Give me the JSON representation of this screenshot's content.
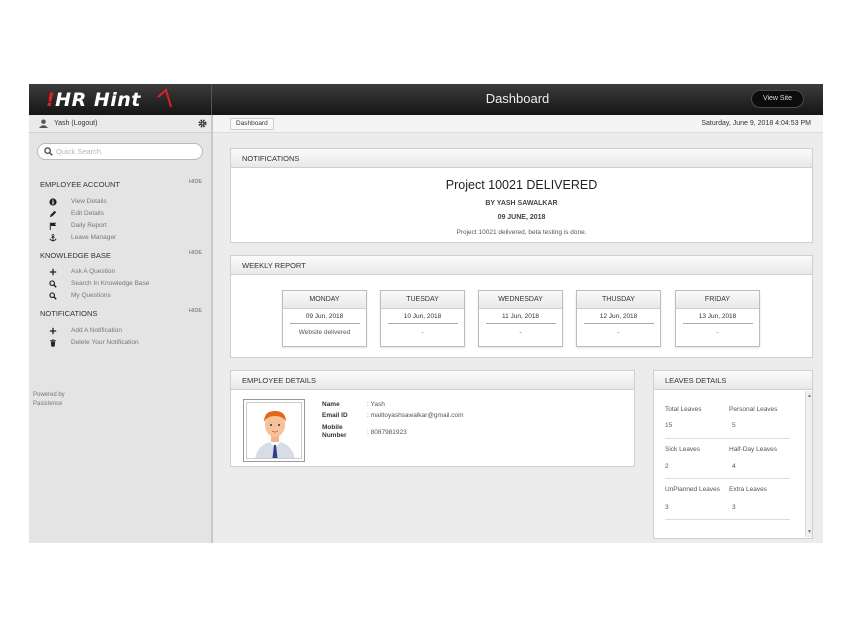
{
  "brand": {
    "logo": "HR Hint",
    "logo_mark": "!"
  },
  "header": {
    "title": "Dashboard",
    "view_site": "View Site"
  },
  "user": {
    "name": "Yash (Logout)"
  },
  "search": {
    "placeholder": "Quick Search"
  },
  "sidebar": {
    "hide_label": "HIDE",
    "employee_account": {
      "title": "EMPLOYEE ACCOUNT",
      "items": [
        {
          "label": "View Details",
          "icon": "info-icon"
        },
        {
          "label": "Edit Details",
          "icon": "pencil-icon"
        },
        {
          "label": "Daily Report",
          "icon": "flag-icon"
        },
        {
          "label": "Leave Manager",
          "icon": "anchor-icon"
        }
      ]
    },
    "knowledge_base": {
      "title": "KNOWLEDGE BASE",
      "items": [
        {
          "label": "Ask A Question",
          "icon": "plus-icon"
        },
        {
          "label": "Search In Knowledge Base",
          "icon": "search-icon"
        },
        {
          "label": "My Questions",
          "icon": "search-icon"
        }
      ]
    },
    "notifications": {
      "title": "NOTIFICATIONS",
      "items": [
        {
          "label": "Add A Notification",
          "icon": "plus-icon"
        },
        {
          "label": "Delete Your Notification",
          "icon": "trash-icon"
        }
      ]
    },
    "powered_by": "Powered by",
    "powered_name": "Pasistence"
  },
  "breadcrumb": {
    "current": "Dashboard"
  },
  "datetime": "Saturday, June 9, 2018 4:04:53 PM",
  "notifications_panel": {
    "title": "NOTIFICATIONS",
    "headline": "Project 10021 DELIVERED",
    "by": "BY YASH SAWALKAR",
    "date": "09 JUNE, 2018",
    "message": "Project 10021 delivered, beta testing is done."
  },
  "weekly_report": {
    "title": "WEEKLY REPORT",
    "days": [
      {
        "day": "MONDAY",
        "date": "09 Jun, 2018",
        "note": "Website delivered"
      },
      {
        "day": "TUESDAY",
        "date": "10 Jun, 2018",
        "note": "-"
      },
      {
        "day": "WEDNESDAY",
        "date": "11 Jun, 2018",
        "note": "-"
      },
      {
        "day": "THUSDAY",
        "date": "12 Jun, 2018",
        "note": "-"
      },
      {
        "day": "FRIDAY",
        "date": "13 Jun, 2018",
        "note": "-"
      }
    ]
  },
  "employee_details": {
    "title": "EMPLOYEE DETAILS",
    "name_label": "Name",
    "name_value": ": Yash",
    "email_label": "Email ID",
    "email_value": ": mailtoyashsawalkar@gmail.com",
    "mobile_label": "Mobile Number",
    "mobile_value": ": 8087981923"
  },
  "leaves_details": {
    "title": "LEAVES DETAILS",
    "items": [
      {
        "label": "Total Leaves",
        "value": "15"
      },
      {
        "label": "Personal Leaves",
        "value": "5"
      },
      {
        "label": "Sick Leaves",
        "value": "2"
      },
      {
        "label": "Half-Day Leaves",
        "value": "4"
      },
      {
        "label": "UnPlanned Leaves",
        "value": "3"
      },
      {
        "label": "Extra Leaves",
        "value": "3"
      }
    ]
  },
  "colors": {
    "topbar": "#1e1e1e",
    "accent": "#e02020",
    "sidebar": "#e4e4e4"
  }
}
